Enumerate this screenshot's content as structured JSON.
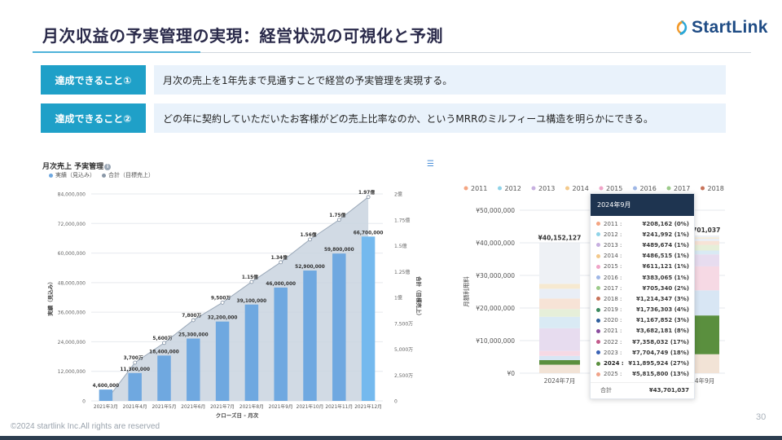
{
  "slide": {
    "title": "月次収益の予実管理の実現：経営状況の可視化と予測",
    "logo_text": "StartLink",
    "footer": "©2024 startlink Inc.All rights are reserved",
    "page_number": "30",
    "accent_color": "#1fa0c8",
    "brand_color": "#1f4c85"
  },
  "achievements": [
    {
      "badge": "達成できること①",
      "text": "月次の売上を1年先まで見通すことで経営の予実管理を実現する。"
    },
    {
      "badge": "達成できること②",
      "text": "どの年に契約していただいたお客様がどの売上比率なのか、というMRRのミルフィーユ構造を明らかにできる。"
    }
  ],
  "chart_data": [
    {
      "type": "bar",
      "title": "月次売上 予実管理",
      "info_icon": "info-icon",
      "legend": [
        "実績（見込み）",
        "合計（目標売上）"
      ],
      "xlabel": "クローズ日 - 月次",
      "ylabel": "実績（見込み）",
      "y2label": "合計（目標売上）",
      "categories": [
        "2021年3月",
        "2021年4月",
        "2021年5月",
        "2021年6月",
        "2021年7月",
        "2021年8月",
        "2021年9月",
        "2021年10月",
        "2021年11月",
        "2021年12月"
      ],
      "series": [
        {
          "name": "実績（見込み）",
          "type": "bar",
          "color": "#6fa8e0",
          "values": [
            4600000,
            11300000,
            18400000,
            25300000,
            32200000,
            39100000,
            46000000,
            52900000,
            59800000,
            66700000
          ],
          "labels": [
            "4,600,000",
            "11,300,000",
            "18,400,000",
            "25,300,000",
            "32,200,000",
            "39,100,000",
            "46,000,000",
            "52,900,000",
            "59,800,000",
            "66,700,000"
          ]
        },
        {
          "name": "合計（目標売上）",
          "type": "area",
          "color": "#c9d3df",
          "values": [
            0,
            37000000,
            56000000,
            78000000,
            95000000,
            115000000,
            134000000,
            156000000,
            175000000,
            197000000
          ],
          "labels": [
            "",
            "3,700万",
            "5,600万",
            "7,800万",
            "9,500万",
            "1.15億",
            "1.34億",
            "1.56億",
            "1.75億",
            "1.97億"
          ]
        }
      ],
      "yticks": [
        "0",
        "12,000,000",
        "24,000,000",
        "36,000,000",
        "48,000,000",
        "60,000,000",
        "72,000,000",
        "84,000,000"
      ],
      "ylim": [
        0,
        84000000
      ],
      "y2ticks": [
        "0",
        "2,500万",
        "5,000万",
        "7,500万",
        "1億",
        "1.25億",
        "1.5億",
        "1.75億",
        "2億"
      ],
      "y2lim": [
        0,
        200000000
      ],
      "grid": true
    },
    {
      "type": "bar",
      "stacked": true,
      "ylabel": "月額利用料",
      "legend_position": "top",
      "series_names": [
        "2011",
        "2012",
        "2013",
        "2014",
        "2015",
        "2016",
        "2017",
        "2018"
      ],
      "series_colors": [
        "#f4a582",
        "#8fd3e8",
        "#c7b0e0",
        "#f3c98b",
        "#f0a5c8",
        "#9fb7e6",
        "#9ccb8a",
        "#c8735a"
      ],
      "yticks": [
        "¥0",
        "¥10,000,000",
        "¥20,000,000",
        "¥30,000,000",
        "¥40,000,000",
        "¥50,000,000"
      ],
      "ylim": [
        0,
        50000000
      ],
      "categories": [
        "2024年7月",
        "2024年9月"
      ],
      "totals": [
        "¥40,152,127",
        "¥43,701,037"
      ],
      "tooltip": {
        "title": "2024年9月",
        "rows": [
          {
            "year": "2011",
            "value": "¥208,162 (0%)",
            "color": "#f4a582"
          },
          {
            "year": "2012",
            "value": "¥241,992 (1%)",
            "color": "#8fd3e8"
          },
          {
            "year": "2013",
            "value": "¥489,674 (1%)",
            "color": "#c7b0e0"
          },
          {
            "year": "2014",
            "value": "¥486,515 (1%)",
            "color": "#f3c98b"
          },
          {
            "year": "2015",
            "value": "¥611,121 (1%)",
            "color": "#f0a5c8"
          },
          {
            "year": "2016",
            "value": "¥383,065 (1%)",
            "color": "#9fb7e6"
          },
          {
            "year": "2017",
            "value": "¥705,340 (2%)",
            "color": "#9ccb8a"
          },
          {
            "year": "2018",
            "value": "¥1,214,347 (3%)",
            "color": "#c8735a"
          },
          {
            "year": "2019",
            "value": "¥1,736,303 (4%)",
            "color": "#3d8a5f"
          },
          {
            "year": "2020",
            "value": "¥1,167,852 (3%)",
            "color": "#2f5f9e"
          },
          {
            "year": "2021",
            "value": "¥3,682,181 (8%)",
            "color": "#8a4d9e"
          },
          {
            "year": "2022",
            "value": "¥7,358,032 (17%)",
            "color": "#c25a8b"
          },
          {
            "year": "2023",
            "value": "¥7,704,749 (18%)",
            "color": "#3a62b5"
          },
          {
            "year": "2024",
            "value": "¥11,895,924 (27%)",
            "color": "#5a8f3e",
            "bold": true
          },
          {
            "year": "2025",
            "value": "¥5,815,800 (13%)",
            "color": "#f0a48a"
          }
        ],
        "total_label": "合計",
        "total_value": "¥43,701,037"
      },
      "stack_values": {
        "2024年7月": [
          2600000,
          1400000,
          1300000,
          1500000,
          7000000,
          3500000,
          2400000,
          3200000,
          3000000,
          1500000,
          12500000
        ],
        "2024年9月": [
          5815800,
          11895924,
          7704749,
          7358032,
          3682181,
          1167852,
          1736303,
          1214347,
          705340,
          383065,
          611121
        ]
      },
      "stack_colors": [
        "#f2e3d6",
        "#5a8f3e",
        "#d8e6f4",
        "#f6d9e4",
        "#e7dcef",
        "#d9eaf4",
        "#e6efd9",
        "#f7e3d6",
        "#e9eef6",
        "#f6e9d0",
        "#eef1f5"
      ]
    }
  ]
}
